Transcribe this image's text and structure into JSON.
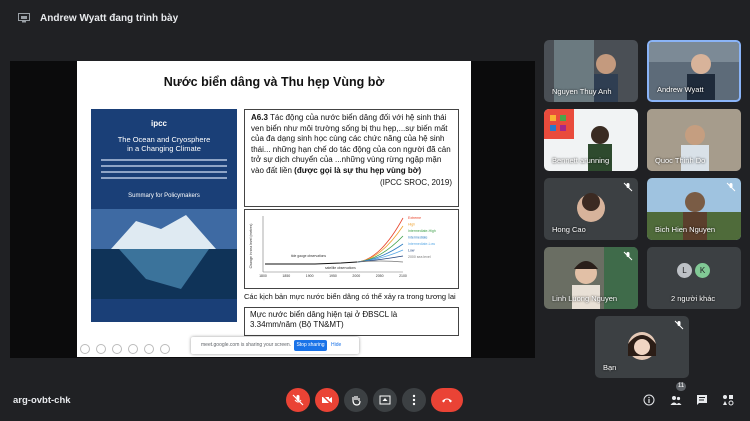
{
  "presenter": {
    "text": "Andrew Wyatt đang trình bày"
  },
  "slide": {
    "title": "Nước biển dâng và Thu hẹp Vùng bờ",
    "report": {
      "logo": "ipcc",
      "title_line1": "The Ocean and Cryosphere",
      "title_line2": "in a Changing Climate",
      "summary": "Summary for Policymakers"
    },
    "quote": {
      "ref": "A6.3",
      "body": "Tác động của nước biển dâng đối với hệ sinh thái ven biển như môi trường sống bị thu hẹp,...sự biến mất của đa dạng sinh học cùng các chức năng của hệ sinh thái... những hạn chế do tác động của con người đã cản trở sự dịch chuyển của ...những vùng rừng ngập mặn vào đất liền",
      "emphasis": "(được gọi là sự thu hẹp vùng bờ)",
      "citation": "(IPCC SROC, 2019)"
    },
    "chart": {
      "ylabel": "Change in sea level (metres)",
      "xticks": [
        "1800",
        "1850",
        "1900",
        "1950",
        "2000",
        "2050",
        "2100"
      ],
      "annotation1": "tide gauge observations",
      "annotation2": "satellite observations",
      "legend": [
        "Extreme",
        "High",
        "Intermediate-High",
        "Intermediate",
        "Intermediate-Low",
        "Low",
        "2000 sea level"
      ],
      "legend_colors": [
        "#e8452c",
        "#f0a330",
        "#3fa04a",
        "#2e7dc1",
        "#5aa9e6",
        "#1c3f7a",
        "#777777"
      ]
    },
    "caption": "Các kịch bản mực nước biển dâng có thể xảy ra trong tương lai",
    "stat_line1": "Mực nước biển dâng hiện tại ở ĐBSCL là",
    "stat_line2": "3.34mm/năm (Bộ TN&MT)"
  },
  "sharebar": {
    "message": "meet.google.com is sharing your screen.",
    "stop": "Stop sharing",
    "hide": "Hide"
  },
  "participants": [
    {
      "name": "Nguyen Thuy Anh"
    },
    {
      "name": "Andrew Wyatt"
    },
    {
      "name": "Bennett arunning"
    },
    {
      "name": "Quoc Thinh Do"
    },
    {
      "name": "Hong Cao"
    },
    {
      "name": "Bich Hien Nguyen"
    },
    {
      "name": "Linh Luong Nguyen"
    },
    {
      "name": "2 người khác",
      "initials": [
        "L",
        "K"
      ]
    },
    {
      "name": "Bạn"
    }
  ],
  "meeting_code": "arg-ovbt-chk",
  "participant_count": "11",
  "colors": {
    "bg": "#202124",
    "tile": "#3c4043",
    "danger": "#ea4335",
    "accent": "#1a73e8"
  }
}
